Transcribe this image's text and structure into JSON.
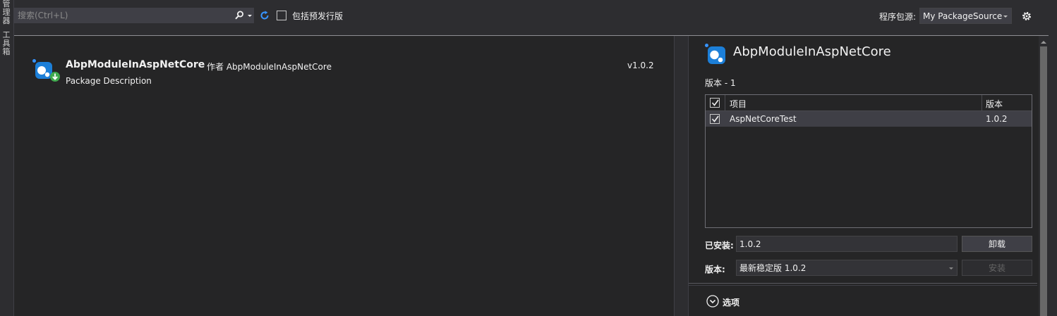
{
  "side_tabs": [
    "管理器",
    "工具箱"
  ],
  "toolbar": {
    "search_placeholder": "搜索(Ctrl+L)",
    "prerelease_label": "包括预发行版",
    "prerelease_checked": false,
    "source_label": "程序包源:",
    "source_value": "My PackageSource"
  },
  "packages": [
    {
      "name": "AbpModuleInAspNetCore",
      "author": "作者 AbpModuleInAspNetCore",
      "description": "Package Description",
      "version": "v1.0.2"
    }
  ],
  "details": {
    "title": "AbpModuleInAspNetCore",
    "version_count_label": "版本 - 1",
    "grid_headers": {
      "project": "项目",
      "version": "版本"
    },
    "projects": [
      {
        "name": "AspNetCoreTest",
        "version": "1.0.2",
        "checked": true
      }
    ],
    "installed_label": "已安装:",
    "installed_value": "1.0.2",
    "uninstall_label": "卸载",
    "version_label": "版本:",
    "version_value": "最新稳定版 1.0.2",
    "install_label": "安装",
    "options_label": "选项"
  },
  "colors": {
    "background": "#2d2d30",
    "panel": "#252526",
    "accent": "#3794ff",
    "text": "#f1f1f1"
  }
}
